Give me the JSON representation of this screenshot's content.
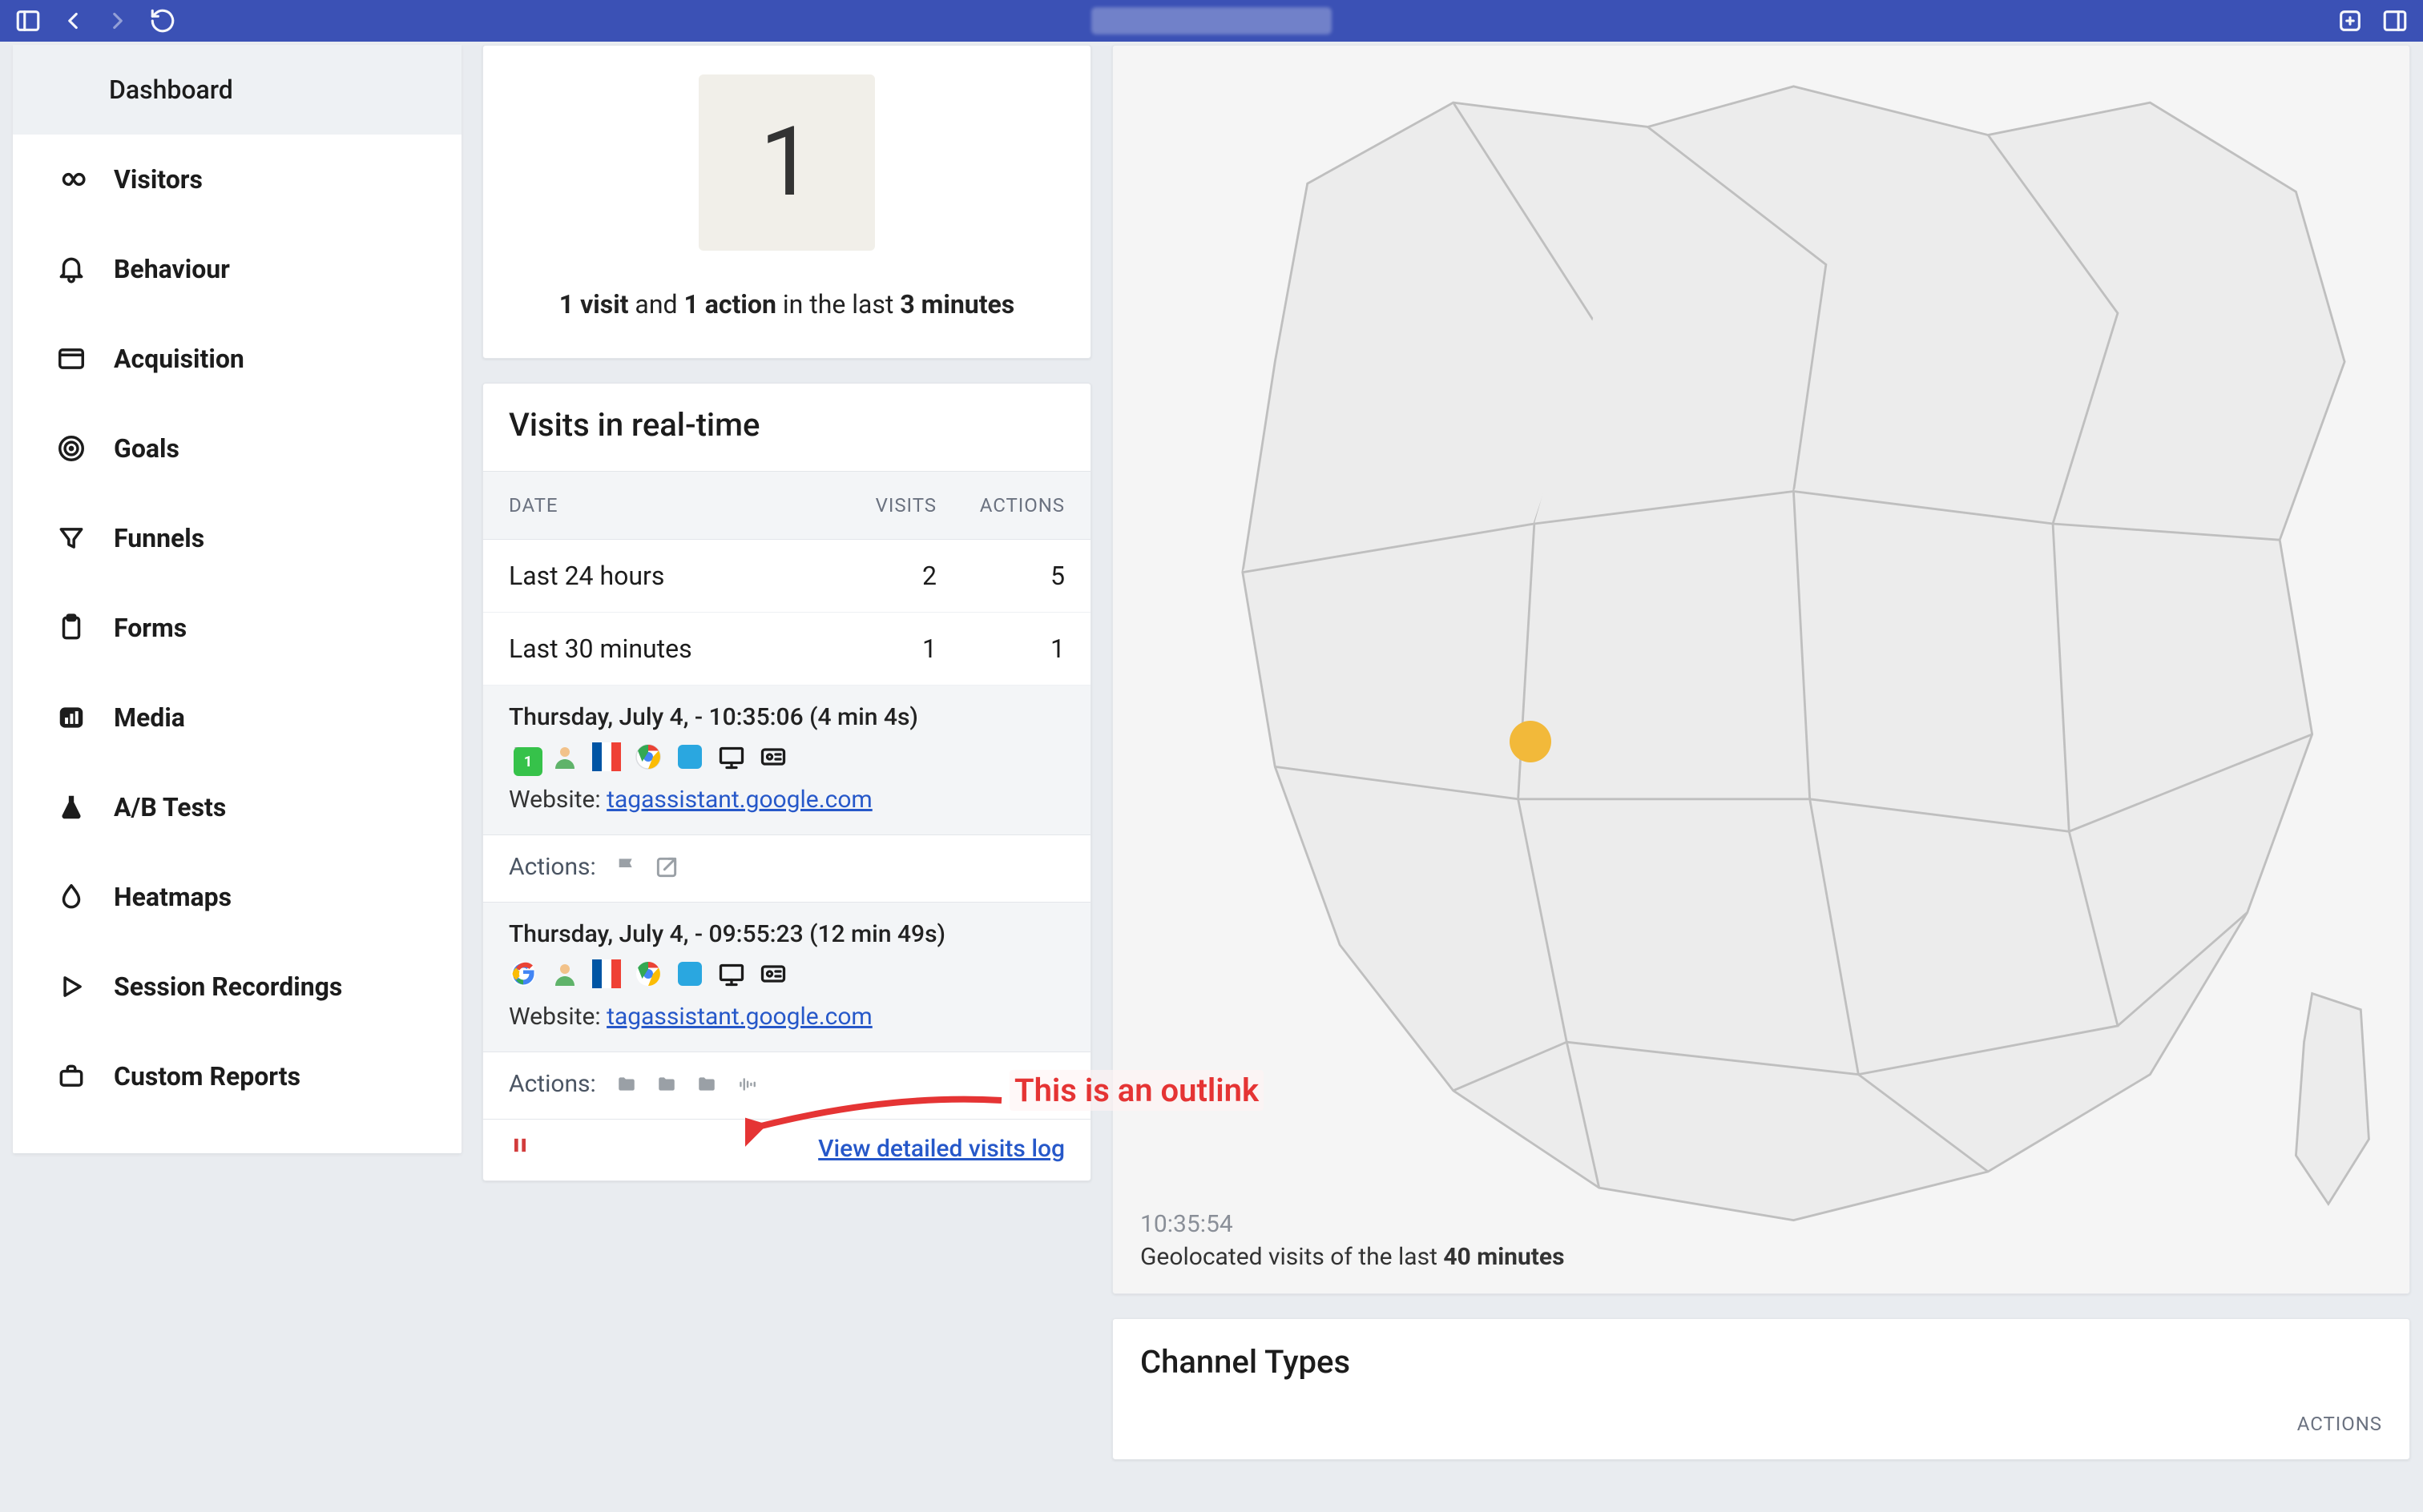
{
  "sidebar": {
    "items": [
      {
        "label": "Dashboard",
        "icon": ""
      },
      {
        "label": "Visitors",
        "icon": "infinity"
      },
      {
        "label": "Behaviour",
        "icon": "bell"
      },
      {
        "label": "Acquisition",
        "icon": "window"
      },
      {
        "label": "Goals",
        "icon": "target"
      },
      {
        "label": "Funnels",
        "icon": "filter"
      },
      {
        "label": "Forms",
        "icon": "clipboard"
      },
      {
        "label": "Media",
        "icon": "chart"
      },
      {
        "label": "A/B Tests",
        "icon": "flask"
      },
      {
        "label": "Heatmaps",
        "icon": "drop"
      },
      {
        "label": "Session Recordings",
        "icon": "play"
      },
      {
        "label": "Custom Reports",
        "icon": "briefcase"
      }
    ]
  },
  "counter": {
    "big_number": "1",
    "text_parts": {
      "visits": "1 visit",
      "and": " and ",
      "actions": "1 action",
      "in_last": " in the last ",
      "minutes": "3 minutes"
    }
  },
  "realtime": {
    "title": "Visits in real-time",
    "columns": {
      "date": "DATE",
      "visits": "VISITS",
      "actions": "ACTIONS"
    },
    "rows": [
      {
        "label": "Last 24 hours",
        "visits": "2",
        "actions": "5"
      },
      {
        "label": "Last 30 minutes",
        "visits": "1",
        "actions": "1"
      }
    ],
    "visits": [
      {
        "line1": "Thursday, July 4, - 10:35:06 (4 min 4s)",
        "website_label": "Website: ",
        "website_url": "tagassistant.google.com",
        "badge_count": "1",
        "country": "fr",
        "browser": "chrome",
        "os": "mac",
        "device": "desktop",
        "actions_label": "Actions:",
        "action_icons": [
          "flag",
          "outlink"
        ]
      },
      {
        "line1": "Thursday, July 4, - 09:55:23 (12 min 49s)",
        "website_label": "Website: ",
        "website_url": "tagassistant.google.com",
        "country": "fr",
        "source": "google",
        "browser": "chrome",
        "os": "mac",
        "device": "desktop",
        "actions_label": "Actions:",
        "action_icons": [
          "folder",
          "folder",
          "folder",
          "equalizer"
        ]
      }
    ],
    "footer_link": "View detailed visits log"
  },
  "map": {
    "timestamp": "10:35:54",
    "caption_prefix": "Geolocated visits of the last ",
    "caption_bold": "40 minutes",
    "dot": {
      "label": "visit-location"
    }
  },
  "channel": {
    "title": "Channel Types",
    "right_label": "ACTIONS"
  },
  "annotation": {
    "text": "This is an outlink"
  }
}
